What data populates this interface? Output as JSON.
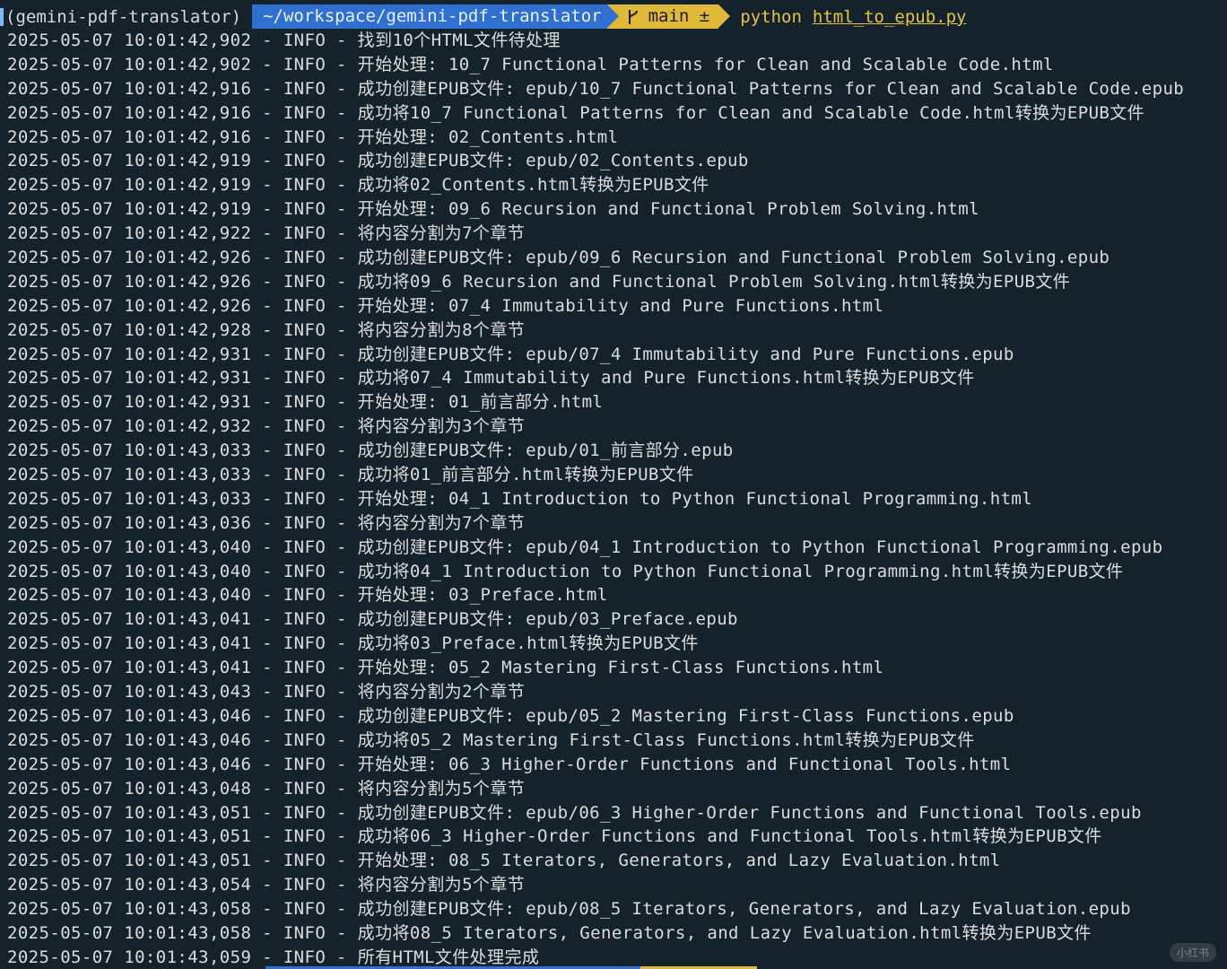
{
  "prompt": {
    "venv": "(gemini-pdf-translator)",
    "path": "~/workspace/gemini-pdf-translator",
    "branch": "main ±",
    "command": "python",
    "argument": "html_to_epub.py"
  },
  "log_lines": [
    "2025-05-07 10:01:42,902 - INFO - 找到10个HTML文件待处理",
    "2025-05-07 10:01:42,902 - INFO - 开始处理: 10_7 Functional Patterns for Clean and Scalable Code.html",
    "2025-05-07 10:01:42,916 - INFO - 成功创建EPUB文件: epub/10_7 Functional Patterns for Clean and Scalable Code.epub",
    "2025-05-07 10:01:42,916 - INFO - 成功将10_7 Functional Patterns for Clean and Scalable Code.html转换为EPUB文件",
    "2025-05-07 10:01:42,916 - INFO - 开始处理: 02_Contents.html",
    "2025-05-07 10:01:42,919 - INFO - 成功创建EPUB文件: epub/02_Contents.epub",
    "2025-05-07 10:01:42,919 - INFO - 成功将02_Contents.html转换为EPUB文件",
    "2025-05-07 10:01:42,919 - INFO - 开始处理: 09_6 Recursion and Functional Problem Solving.html",
    "2025-05-07 10:01:42,922 - INFO - 将内容分割为7个章节",
    "2025-05-07 10:01:42,926 - INFO - 成功创建EPUB文件: epub/09_6 Recursion and Functional Problem Solving.epub",
    "2025-05-07 10:01:42,926 - INFO - 成功将09_6 Recursion and Functional Problem Solving.html转换为EPUB文件",
    "2025-05-07 10:01:42,926 - INFO - 开始处理: 07_4 Immutability and Pure Functions.html",
    "2025-05-07 10:01:42,928 - INFO - 将内容分割为8个章节",
    "2025-05-07 10:01:42,931 - INFO - 成功创建EPUB文件: epub/07_4 Immutability and Pure Functions.epub",
    "2025-05-07 10:01:42,931 - INFO - 成功将07_4 Immutability and Pure Functions.html转换为EPUB文件",
    "2025-05-07 10:01:42,931 - INFO - 开始处理: 01_前言部分.html",
    "2025-05-07 10:01:42,932 - INFO - 将内容分割为3个章节",
    "2025-05-07 10:01:43,033 - INFO - 成功创建EPUB文件: epub/01_前言部分.epub",
    "2025-05-07 10:01:43,033 - INFO - 成功将01_前言部分.html转换为EPUB文件",
    "2025-05-07 10:01:43,033 - INFO - 开始处理: 04_1 Introduction to Python Functional Programming.html",
    "2025-05-07 10:01:43,036 - INFO - 将内容分割为7个章节",
    "2025-05-07 10:01:43,040 - INFO - 成功创建EPUB文件: epub/04_1 Introduction to Python Functional Programming.epub",
    "2025-05-07 10:01:43,040 - INFO - 成功将04_1 Introduction to Python Functional Programming.html转换为EPUB文件",
    "2025-05-07 10:01:43,040 - INFO - 开始处理: 03_Preface.html",
    "2025-05-07 10:01:43,041 - INFO - 成功创建EPUB文件: epub/03_Preface.epub",
    "2025-05-07 10:01:43,041 - INFO - 成功将03_Preface.html转换为EPUB文件",
    "2025-05-07 10:01:43,041 - INFO - 开始处理: 05_2 Mastering First-Class Functions.html",
    "2025-05-07 10:01:43,043 - INFO - 将内容分割为2个章节",
    "2025-05-07 10:01:43,046 - INFO - 成功创建EPUB文件: epub/05_2 Mastering First-Class Functions.epub",
    "2025-05-07 10:01:43,046 - INFO - 成功将05_2 Mastering First-Class Functions.html转换为EPUB文件",
    "2025-05-07 10:01:43,046 - INFO - 开始处理: 06_3 Higher-Order Functions and Functional Tools.html",
    "2025-05-07 10:01:43,048 - INFO - 将内容分割为5个章节",
    "2025-05-07 10:01:43,051 - INFO - 成功创建EPUB文件: epub/06_3 Higher-Order Functions and Functional Tools.epub",
    "2025-05-07 10:01:43,051 - INFO - 成功将06_3 Higher-Order Functions and Functional Tools.html转换为EPUB文件",
    "2025-05-07 10:01:43,051 - INFO - 开始处理: 08_5 Iterators, Generators, and Lazy Evaluation.html",
    "2025-05-07 10:01:43,054 - INFO - 将内容分割为5个章节",
    "2025-05-07 10:01:43,058 - INFO - 成功创建EPUB文件: epub/08_5 Iterators, Generators, and Lazy Evaluation.epub",
    "2025-05-07 10:01:43,058 - INFO - 成功将08_5 Iterators, Generators, and Lazy Evaluation.html转换为EPUB文件",
    "2025-05-07 10:01:43,059 - INFO - 所有HTML文件处理完成"
  ],
  "watermark": "小红书",
  "icons": {
    "branch": "git-branch-icon"
  },
  "colors": {
    "background": "#14232b",
    "path_segment": "#2e6fd0",
    "git_segment": "#e0b93a",
    "command": "#e5c24b"
  }
}
